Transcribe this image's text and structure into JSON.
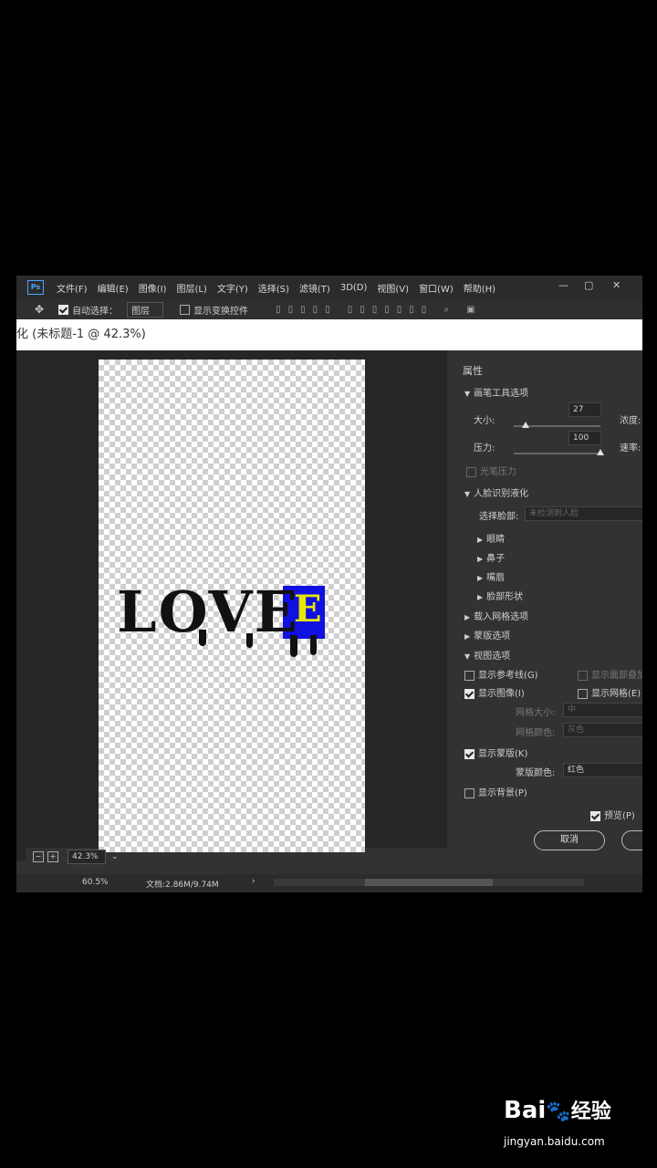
{
  "app": {
    "logo": "Ps",
    "menu": [
      "文件(F)",
      "编辑(E)",
      "图像(I)",
      "图层(L)",
      "文字(Y)",
      "选择(S)",
      "滤镜(T)",
      "3D(D)",
      "视图(V)",
      "窗口(W)",
      "帮助(H)"
    ],
    "window_controls": {
      "minimize": "—",
      "restore": "▢",
      "close": "✕"
    }
  },
  "options": {
    "auto_select_label": "自动选择：",
    "layer_select": "图层",
    "show_transform_label": "显示变换控件"
  },
  "dialog": {
    "title": "化 (未标题-1 @ 42.3%)",
    "canvas_text": "LOVE",
    "canvas_e": "E",
    "zoom_minus": "−",
    "zoom_plus": "+",
    "zoom_value": "42.3%",
    "panel": {
      "header": "属性",
      "brush_section": "画笔工具选项",
      "size_label": "大小:",
      "size_value": "27",
      "size_level": 0.14,
      "density_label": "浓度:",
      "pressure_label": "压力:",
      "pressure_value": "100",
      "pressure_level": 1.0,
      "rate_label": "速率:",
      "stylus_label": "光笔压力",
      "face_section": "人脸识别液化",
      "select_face_label": "选择脸部:",
      "select_face_value": "未检测到人脸",
      "eyes": "眼睛",
      "nose": "鼻子",
      "mouth": "嘴唇",
      "face_shape": "脸部形状",
      "load_mesh": "载入网格选项",
      "mask_options": "蒙版选项",
      "view_options": "视图选项",
      "show_guides": "显示参考线(G)",
      "show_face_overlay": "显示面部叠加",
      "show_image": "显示图像(I)",
      "show_mesh": "显示网格(E)",
      "mesh_size_label": "网格大小:",
      "mesh_size_value": "中",
      "mesh_color_label": "网格颜色:",
      "mesh_color_value": "灰色",
      "show_mask": "显示蒙版(K)",
      "mask_color_label": "蒙版颜色:",
      "mask_color_value": "红色",
      "show_backdrop": "显示背景(P)",
      "preview": "预览(P)",
      "cancel": "取消"
    }
  },
  "status": {
    "zoom": "60.5%",
    "doc": "文档:2.86M/9.74M"
  },
  "watermark": {
    "logo_a": "Bai",
    "logo_b": "经验",
    "url": "jingyan.baidu.com"
  },
  "colors": {
    "ui_bg": "#2b2b2b",
    "panel_bg": "#323232",
    "blue_box": "#1010e0",
    "yellow_e": "#e8e800",
    "ps_blue": "#4aa3ff"
  }
}
